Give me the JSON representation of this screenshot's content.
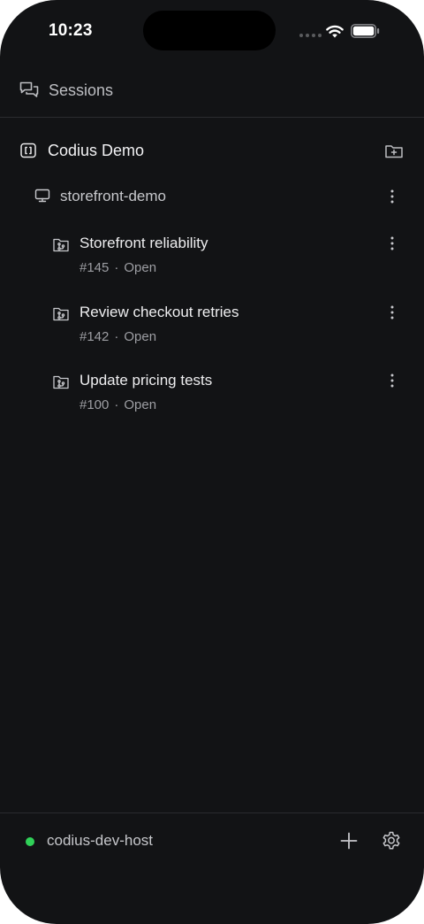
{
  "status_bar": {
    "time": "10:23"
  },
  "header": {
    "title": "Sessions",
    "icon": "chat-bubbles-icon"
  },
  "workspace": {
    "name": "Codius Demo",
    "icon": "code-brackets-icon",
    "action_icon": "folder-plus-icon"
  },
  "repository": {
    "name": "storefront-demo",
    "icon": "monitor-icon"
  },
  "sessions": [
    {
      "title": "Storefront reliability",
      "number": "#145",
      "separator": "·",
      "status": "Open"
    },
    {
      "title": "Review checkout retries",
      "number": "#142",
      "separator": "·",
      "status": "Open"
    },
    {
      "title": "Update pricing tests",
      "number": "#100",
      "separator": "·",
      "status": "Open"
    }
  ],
  "footer": {
    "host": "codius-dev-host",
    "host_status_color": "#30d158",
    "add_icon": "plus-icon",
    "settings_icon": "gear-icon"
  }
}
